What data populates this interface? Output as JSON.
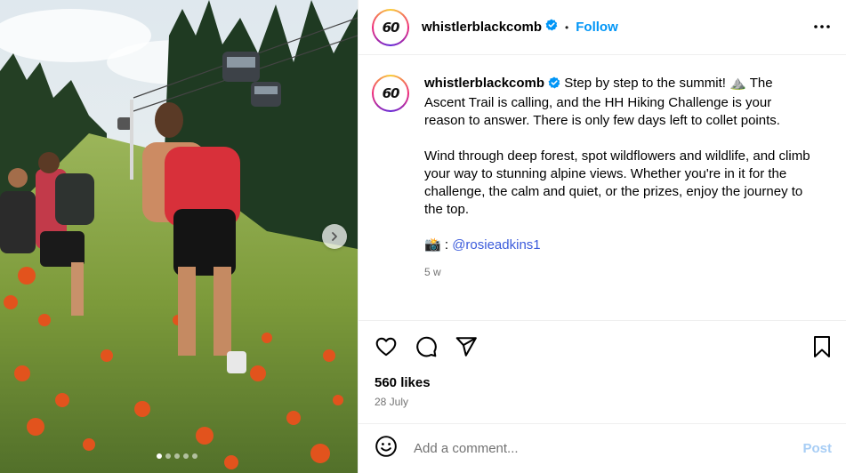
{
  "post": {
    "username": "whistlerblackcomb",
    "follow_label": "Follow",
    "separator": "•",
    "avatar_logo_text": "60",
    "caption": {
      "line1": "Step by step to the summit! ⛰️ The Ascent Trail is calling, and the HH Hiking Challenge is your reason to answer. There is only few days left to collet points.",
      "line2": "Wind through deep forest, spot wildflowers and wildlife, and climb your way to stunning alpine views. Whether you're in it for the challenge, the calm and quiet, or the prizes, enjoy the journey to the top.",
      "credit_prefix": "📸 : ",
      "mention": "@rosieadkins1"
    },
    "age": "5 w",
    "likes": "560 likes",
    "date": "28 July"
  },
  "comment": {
    "placeholder": "Add a comment...",
    "post_label": "Post"
  },
  "carousel": {
    "dot_count": 5,
    "active_index": 0
  },
  "icons": {
    "verified": "verified-badge-icon",
    "more": "more-options-icon",
    "like": "heart-icon",
    "comment": "comment-bubble-icon",
    "share": "paper-plane-icon",
    "save": "bookmark-icon",
    "emoji": "smiley-icon",
    "next": "chevron-right-icon"
  },
  "colors": {
    "accent": "#0095f6",
    "mention": "#3b5bdb",
    "muted": "#737373",
    "post_disabled": "#a7cdf5"
  }
}
